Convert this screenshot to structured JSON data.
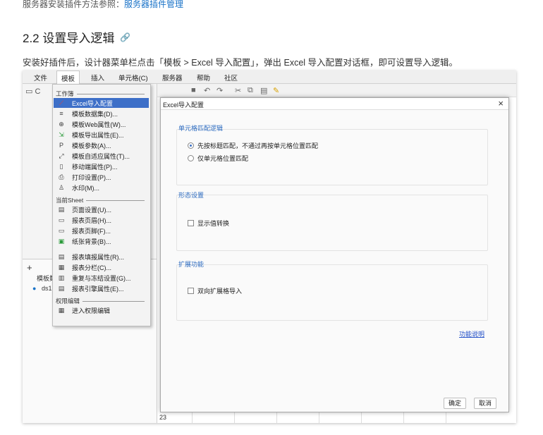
{
  "doc": {
    "top_line_prefix": "服务器安装插件方法参照：",
    "top_line_link": "服务器插件管理",
    "heading": "2.2 设置导入逻辑",
    "intro": "安装好插件后，设计器菜单栏点击「模板 > Excel 导入配置」，弹出 Excel 导入配置对话框，即可设置导入逻辑。"
  },
  "menubar": [
    "文件",
    "模板",
    "插入",
    "单元格(C)",
    "服务器",
    "帮助",
    "社区"
  ],
  "left_panel": {
    "template_label": "模板数",
    "ds_label": "ds1",
    "add_label": "+"
  },
  "dropdown": {
    "section_workbook": "工作簿",
    "items_workbook": [
      {
        "icon": "excel-import-icon",
        "glyph": "⟋",
        "label": "Excel导入配置",
        "selected": true
      },
      {
        "icon": "dataset-icon",
        "glyph": "≡",
        "label": "模板数据集(D)..."
      },
      {
        "icon": "web-icon",
        "glyph": "⊕",
        "label": "模板Web属性(W)..."
      },
      {
        "icon": "export-icon",
        "glyph": "⇲",
        "label": "模板导出属性(E)..."
      },
      {
        "icon": "param-icon",
        "glyph": "P",
        "label": "模板参数(A)..."
      },
      {
        "icon": "adapt-icon",
        "glyph": "⤢",
        "label": "模板自适应属性(T)..."
      },
      {
        "icon": "mobile-icon",
        "glyph": "▯",
        "label": "移动端属性(P)..."
      },
      {
        "icon": "print-icon",
        "glyph": "⎙",
        "label": "打印设置(P)..."
      },
      {
        "icon": "watermark-icon",
        "glyph": "♙",
        "label": "水印(M)..."
      }
    ],
    "section_sheet": "当前Sheet",
    "items_sheet": [
      {
        "icon": "page-setup-icon",
        "glyph": "▤",
        "label": "页面设置(U)..."
      },
      {
        "icon": "header-icon",
        "glyph": "▭",
        "label": "报表页眉(H)..."
      },
      {
        "icon": "footer-icon",
        "glyph": "▭",
        "label": "报表页脚(F)..."
      },
      {
        "icon": "paper-bg-icon",
        "glyph": "▣",
        "label": "纸张背景(B)..."
      },
      {
        "icon": "fill-attr-icon",
        "glyph": "▤",
        "label": "报表填报属性(R)..."
      },
      {
        "icon": "columns-icon",
        "glyph": "▦",
        "label": "报表分栏(C)..."
      },
      {
        "icon": "freeze-icon",
        "glyph": "▥",
        "label": "重复与冻结设置(G)..."
      },
      {
        "icon": "engine-icon",
        "glyph": "▤",
        "label": "报表引擎属性(E)..."
      }
    ],
    "section_perm": "权限编辑",
    "items_perm": [
      {
        "icon": "perm-edit-icon",
        "glyph": "▦",
        "label": "进入权限编辑"
      }
    ]
  },
  "dialog": {
    "title": "Excel导入配置",
    "group1_title": "单元格匹配逻辑",
    "radio1": "先按标题匹配，不通过再按单元格位置匹配",
    "radio2": "仅单元格位置匹配",
    "group2_title": "形态设置",
    "check_display": "显示值转换",
    "group3_title": "扩展功能",
    "check_expand": "双向扩展格导入",
    "help_link": "功能说明",
    "ok": "确定",
    "cancel": "取消"
  },
  "sheet": {
    "row_label": "23"
  }
}
